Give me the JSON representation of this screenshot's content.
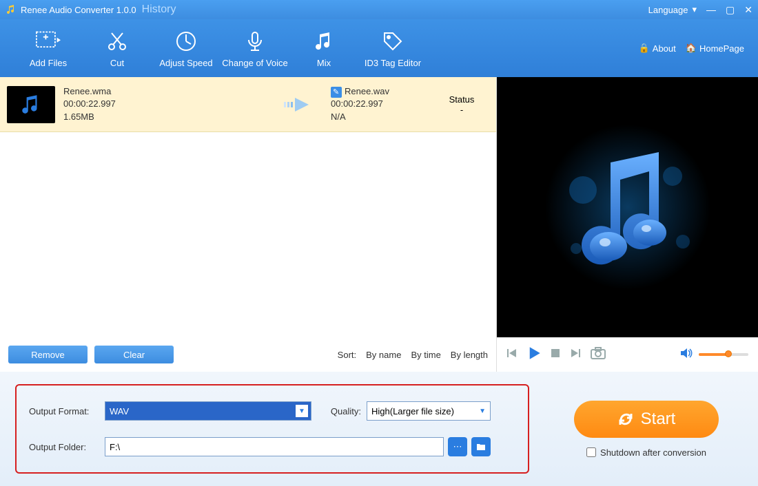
{
  "title": {
    "app": "Renee Audio Converter 1.0.0",
    "history": "History"
  },
  "win": {
    "language": "Language"
  },
  "toolbar": {
    "addfiles": "Add Files",
    "cut": "Cut",
    "adjustspeed": "Adjust Speed",
    "changevoice": "Change of Voice",
    "mix": "Mix",
    "id3": "ID3 Tag Editor",
    "about": "About",
    "homepage": "HomePage"
  },
  "file": {
    "src": {
      "name": "Renee.wma",
      "duration": "00:00:22.997",
      "size": "1.65MB"
    },
    "dst": {
      "name": "Renee.wav",
      "duration": "00:00:22.997",
      "size": "N/A"
    },
    "status_label": "Status",
    "status_value": "-"
  },
  "actions": {
    "remove": "Remove",
    "clear": "Clear"
  },
  "sort": {
    "label": "Sort:",
    "byname": "By name",
    "bytime": "By time",
    "bylength": "By length"
  },
  "output": {
    "format_label": "Output Format:",
    "format_value": "WAV",
    "quality_label": "Quality:",
    "quality_value": "High(Larger file size)",
    "folder_label": "Output Folder:",
    "folder_value": "F:\\"
  },
  "start": {
    "label": "Start",
    "shutdown": "Shutdown after conversion"
  }
}
